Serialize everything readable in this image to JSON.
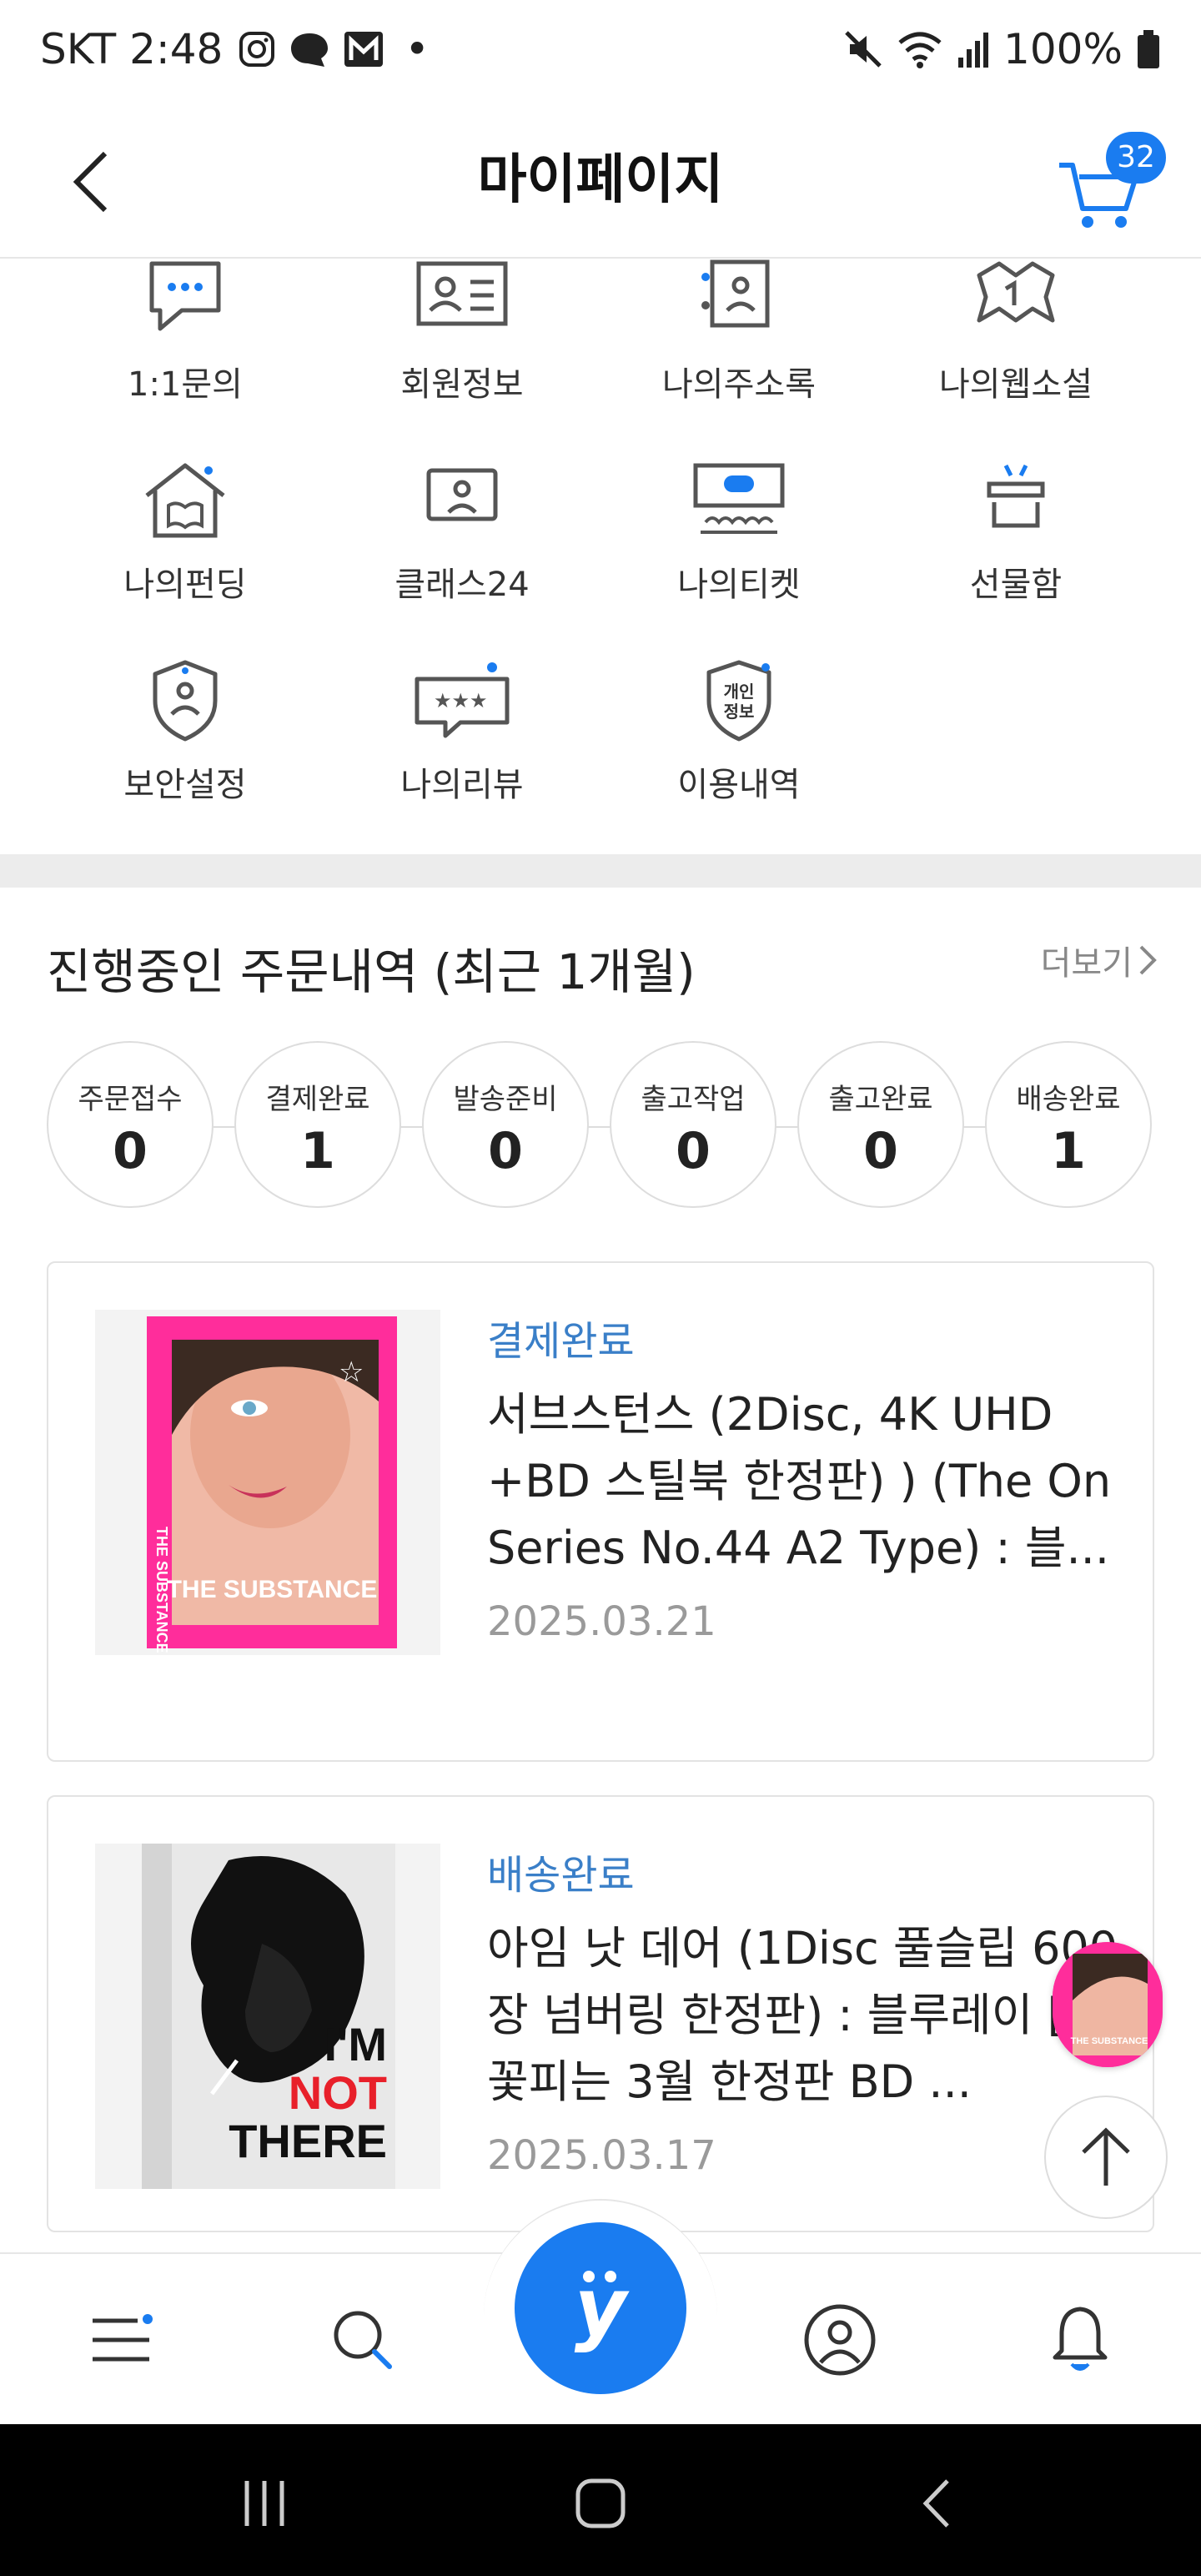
{
  "status_bar": {
    "carrier_time": "SKT 2:48",
    "dot": "•",
    "battery": "100%",
    "icons": [
      "instagram-icon",
      "thread-icon",
      "gmail-icon",
      "mute-icon",
      "wifi-icon",
      "signal-icon",
      "battery-icon"
    ]
  },
  "header": {
    "title": "마이페이지",
    "cart_count": "32"
  },
  "menu": {
    "items": [
      {
        "label": "1:1문의",
        "icon": "chat-bubble-icon"
      },
      {
        "label": "회원정보",
        "icon": "id-card-icon"
      },
      {
        "label": "나의주소록",
        "icon": "address-book-icon"
      },
      {
        "label": "나의웹소설",
        "icon": "book-open-icon"
      },
      {
        "label": "나의펀딩",
        "icon": "house-book-icon"
      },
      {
        "label": "클래스24",
        "icon": "monitor-person-icon"
      },
      {
        "label": "나의티켓",
        "icon": "ticket-stage-icon"
      },
      {
        "label": "선물함",
        "icon": "gift-box-icon"
      },
      {
        "label": "보안설정",
        "icon": "shield-icon"
      },
      {
        "label": "나의리뷰",
        "icon": "review-stars-icon"
      },
      {
        "label": "이용내역",
        "icon": "privacy-badge-icon"
      }
    ],
    "privacy_badge_text_1": "개인",
    "privacy_badge_text_2": "정보"
  },
  "orders": {
    "section_title": "진행중인 주문내역 (최근 1개월)",
    "more_label": "더보기",
    "steps": [
      {
        "label": "주문접수",
        "count": "0"
      },
      {
        "label": "결제완료",
        "count": "1"
      },
      {
        "label": "발송준비",
        "count": "0"
      },
      {
        "label": "출고작업",
        "count": "0"
      },
      {
        "label": "출고완료",
        "count": "0"
      },
      {
        "label": "배송완료",
        "count": "1"
      }
    ],
    "list": [
      {
        "status": "결제완료",
        "title": "서브스턴스 (2Disc, 4K UHD +BD 스틸북 한정판) ) (The On Series No.44 A2 Type) : 블...",
        "date": "2025.03.21",
        "cover_text": "THE SUBSTANCE"
      },
      {
        "status": "배송완료",
        "title": "아임 낫 데어 (1Disc 풀슬립 600장 넘버링 한정판) : 블루레이 [벚꽃피는 3월 한정판 BD ...",
        "date": "2025.03.17",
        "cover_text_1": "I'M",
        "cover_text_2": "NOT",
        "cover_text_3": "THERE"
      }
    ]
  },
  "colors": {
    "accent": "#1a7cf0",
    "status_blue": "#3a7fc8",
    "pink": "#ff2d9b"
  }
}
